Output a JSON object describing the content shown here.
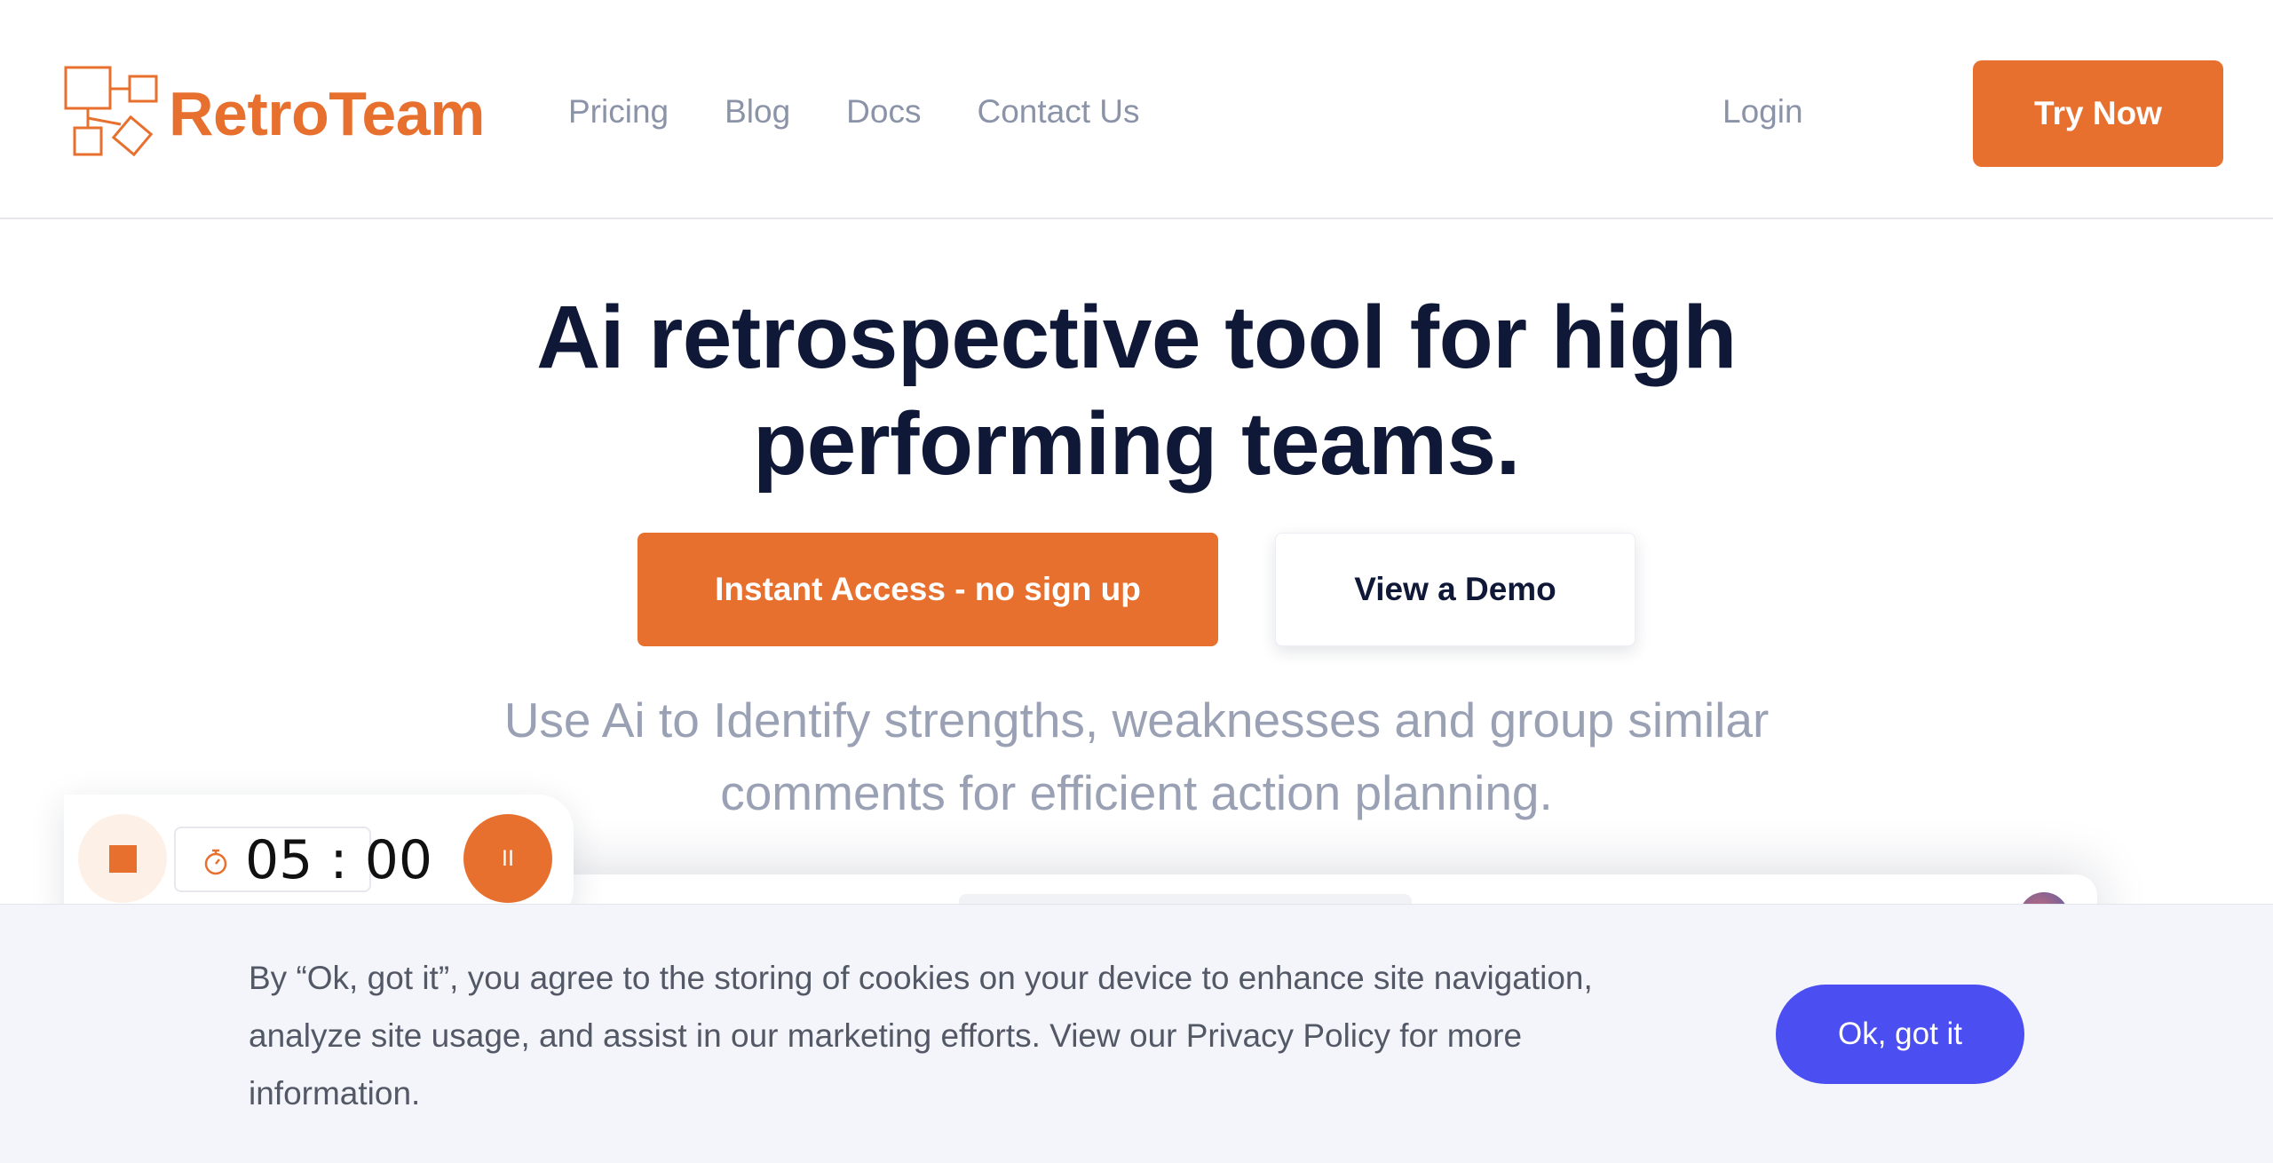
{
  "header": {
    "logo_text": "RetroTeam",
    "nav": [
      "Pricing",
      "Blog",
      "Docs",
      "Contact Us"
    ],
    "login_label": "Login",
    "try_now_label": "Try Now"
  },
  "hero": {
    "title_line1": "Ai retrospective tool for high",
    "title_line2": "performing teams.",
    "primary_cta": "Instant Access - no sign up",
    "secondary_cta": "View a Demo",
    "subtitle_line1": "Use Ai to Identify strengths, weaknesses and group similar",
    "subtitle_line2": "comments for efficient action planning."
  },
  "timer": {
    "value": "05 : 00",
    "pause_glyph": "II"
  },
  "cookie_banner": {
    "text": "By “Ok, got it”, you agree to the storing of cookies on your device to enhance site navigation, analyze site usage, and assist in our marketing efforts. View our Privacy Policy for more information.",
    "button_label": "Ok, got it"
  },
  "colors": {
    "brand_orange": "#E8702F",
    "heading_navy": "#0f1837",
    "muted_gray": "#9aa1b4",
    "cookie_button_blue": "#4b4ef0"
  },
  "icons": [
    "logo-boxes-icon",
    "stopwatch-icon",
    "stop-icon",
    "pause-icon"
  ]
}
